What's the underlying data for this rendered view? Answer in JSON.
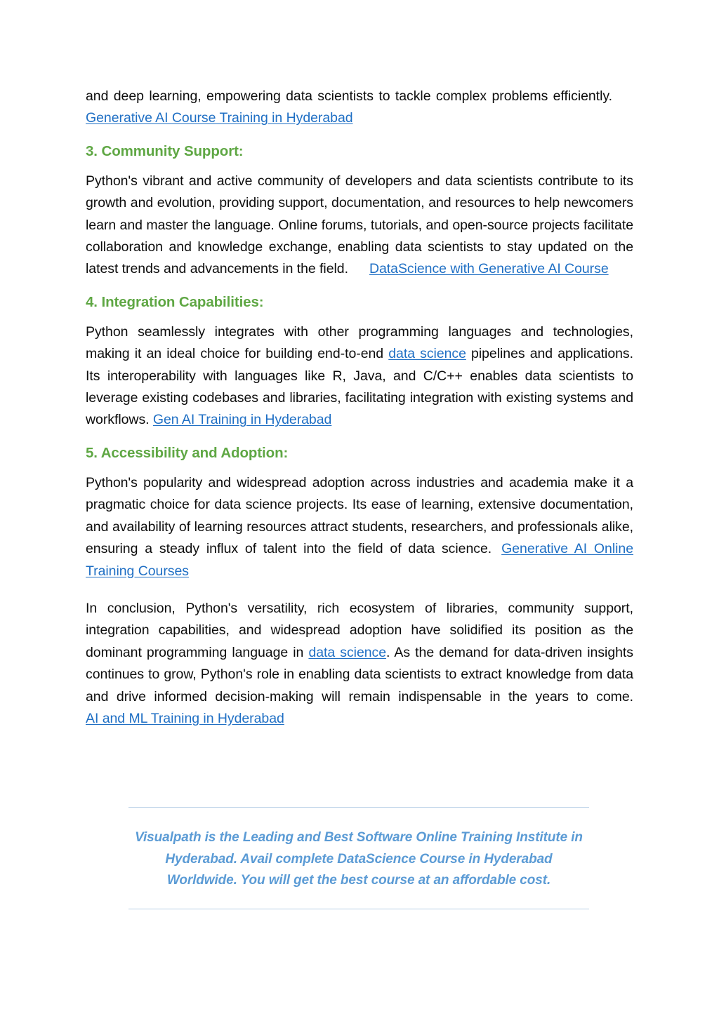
{
  "document": {
    "page_background": "#ffffff",
    "text_color": "#0d0d0d",
    "heading_color": "#5fa744",
    "link_color": "#1f6fc4",
    "footer_color": "#5b9bd5",
    "footer_rule_color": "#b7cfe6"
  },
  "continued_paragraph": {
    "text": "and deep learning, empowering data scientists to tackle complex problems efficiently.",
    "link": "Generative AI Course Training in Hyderabad"
  },
  "sections": [
    {
      "heading": "3. Community Support:",
      "paragraph": "Python's vibrant and active community of developers and data scientists contribute to its growth and evolution, providing support, documentation, and resources to help newcomers learn and master the language. Online forums, tutorials, and open-source projects facilitate collaboration and knowledge exchange, enabling data scientists to stay updated on the latest trends and advancements in the field.",
      "link": "DataScience with Generative AI Course"
    },
    {
      "heading": "4. Integration Capabilities:",
      "paragraph_part1": "Python seamlessly integrates with other programming languages and technologies, making it an ideal choice for building end-to-end ",
      "inline_link": "data science",
      "paragraph_part2": " pipelines and applications. Its interoperability with languages like R, Java, and C/C++ enables data scientists to leverage existing codebases and libraries, facilitating integration with existing systems and workflows. ",
      "link": "Gen AI Training in Hyderabad"
    },
    {
      "heading": "5. Accessibility and Adoption:",
      "paragraph": "Python's popularity and widespread adoption across industries and academia make it a pragmatic choice for data science projects. Its ease of learning, extensive documentation, and availability of learning resources attract students, researchers, and professionals alike, ensuring a steady influx of talent into the field of data science.",
      "link": "Generative AI Online Training Courses"
    }
  ],
  "conclusion": {
    "part1": "In conclusion, Python's versatility, rich ecosystem of libraries, community support, integration capabilities, and widespread adoption have solidified its position as the dominant programming language in ",
    "inline_link": "data science",
    "part2": ". As the demand for data-driven insights continues to grow, Python's role in enabling data scientists to extract knowledge from data and drive informed decision-making will remain indispensable in the years to come. ",
    "link": "AI and ML Training in Hyderabad"
  },
  "footer": {
    "text": "Visualpath is the Leading and Best Software Online Training Institute in Hyderabad. Avail complete DataScience Course in Hyderabad Worldwide. You will get the best course at an affordable cost."
  }
}
